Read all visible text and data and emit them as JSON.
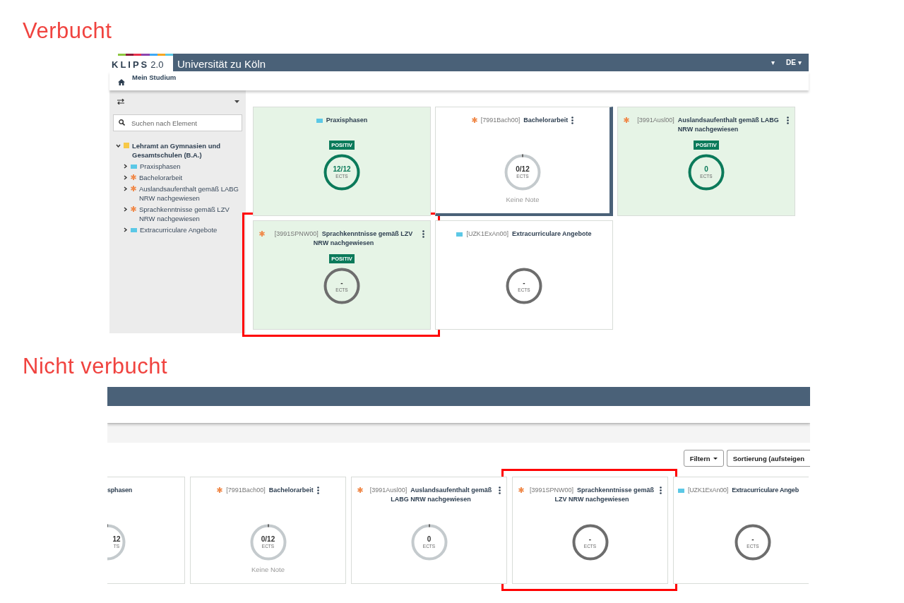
{
  "views": [
    {
      "heading": "Verbucht",
      "kind": "sidebar_view",
      "header": {
        "logo": "KLIPS",
        "logo_version": "2.0",
        "title": "Universität zu Köln",
        "user_caret": "▾",
        "language": "DE",
        "language_caret": "▾",
        "breadcrumb": "Mein Studium"
      },
      "sidebar": {
        "search": {
          "placeholder": "Suchen nach Element"
        },
        "tree": [
          {
            "label": "Lehramt an Gymnasien und Gesamtschulen (B.A.)",
            "kind": "square",
            "expanded": true,
            "children": [
              {
                "label": "Praxisphasen",
                "kind": "bar",
                "expanded": false
              },
              {
                "label": "Bachelorarbeit",
                "kind": "star",
                "expanded": false
              },
              {
                "label": "Auslandsaufenthalt gemäß LABG NRW nachgewiesen",
                "kind": "star",
                "expanded": false
              },
              {
                "label": "Sprachkenntnisse gemäß LZV NRW nachgewiesen",
                "kind": "star",
                "expanded": false
              },
              {
                "label": "Extracurriculare Angebote",
                "kind": "bar",
                "expanded": false
              }
            ]
          }
        ]
      },
      "cards": [
        {
          "kind": "bar",
          "title": "Praxisphasen",
          "menu": false,
          "positive": true,
          "badge": "POSITIV",
          "ring": {
            "kind": "done",
            "value": "12/12",
            "unit": "ECTS"
          },
          "focused": false,
          "highlighted": false
        },
        {
          "kind": "star",
          "code": "[7991Bach00]",
          "title": "Bachelorarbeit",
          "menu": true,
          "positive": false,
          "ring": {
            "kind": "open",
            "value": "0/12",
            "unit": "ECTS"
          },
          "note": "Keine Note",
          "focused": true,
          "highlighted": false
        },
        {
          "kind": "star",
          "code": "[3991Ausl00]",
          "title": "Auslandsaufenthalt gemäß LABG NRW nachgewiesen",
          "menu": true,
          "positive": true,
          "badge": "POSITIV",
          "ring": {
            "kind": "done",
            "value": "0",
            "unit": "ECTS"
          },
          "focused": false,
          "highlighted": false
        },
        {
          "kind": "star",
          "code": "[3991SPNW00]",
          "title": "Sprachkenntnisse gemäß LZV NRW nachgewiesen",
          "menu": true,
          "positive": true,
          "badge": "POSITIV",
          "ring": {
            "kind": "none",
            "value": "-",
            "unit": "ECTS"
          },
          "focused": false,
          "highlighted": true
        },
        {
          "kind": "bar",
          "code": "[UZK1ExAn00]",
          "title": "Extracurriculare Angebote",
          "menu": false,
          "positive": false,
          "ring": {
            "kind": "none",
            "value": "-",
            "unit": "ECTS"
          },
          "focused": false,
          "highlighted": false
        }
      ]
    },
    {
      "heading": "Nicht verbucht",
      "kind": "scrolled_view",
      "buttons": [
        {
          "label": "Filtern",
          "caret": true
        },
        {
          "label": "Sortierung (aufsteigen",
          "caret": false
        }
      ],
      "cards": [
        {
          "clipped_left": true,
          "title": "sphasen",
          "positive": false,
          "ring": {
            "kind": "open",
            "value": "12",
            "unit": "TS"
          },
          "focused": false,
          "highlighted": false
        },
        {
          "kind": "star",
          "code": "[7991Bach00]",
          "title": "Bachelorarbeit",
          "menu": true,
          "positive": false,
          "ring": {
            "kind": "open",
            "value": "0/12",
            "unit": "ECTS"
          },
          "note": "Keine Note",
          "focused": false,
          "highlighted": false
        },
        {
          "kind": "star",
          "code": "[3991Ausl00]",
          "title": "Auslandsaufenthalt gemäß LABG NRW nachgewiesen",
          "menu": true,
          "positive": false,
          "ring": {
            "kind": "open",
            "value": "0",
            "unit": "ECTS"
          },
          "focused": false,
          "highlighted": false
        },
        {
          "kind": "star",
          "code": "[3991SPNW00]",
          "title": "Sprachkenntnisse gemäß LZV NRW nachgewiesen",
          "menu": true,
          "positive": false,
          "ring": {
            "kind": "none",
            "value": "-",
            "unit": "ECTS"
          },
          "focused": false,
          "highlighted": true
        },
        {
          "clipped_right": true,
          "kind": "bar",
          "code": "[UZK1ExAn00]",
          "title": "Extracurriculare Angeb",
          "positive": false,
          "ring": {
            "kind": "none",
            "value": "-",
            "unit": "ECTS"
          },
          "focused": false,
          "highlighted": false
        }
      ]
    }
  ]
}
